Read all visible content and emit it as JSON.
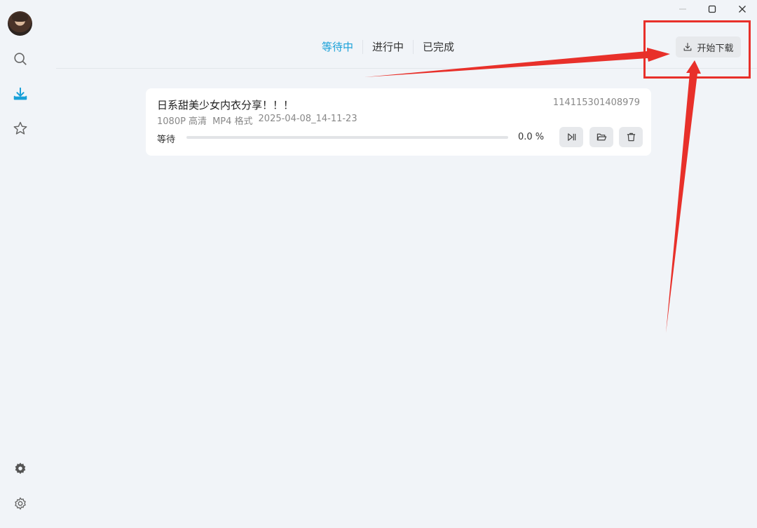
{
  "window": {
    "controls": [
      "minimize",
      "maximize",
      "close"
    ]
  },
  "sidebar": {
    "items": [
      {
        "name": "search",
        "icon": "search-icon"
      },
      {
        "name": "download",
        "icon": "download-icon",
        "active": true
      },
      {
        "name": "favorites",
        "icon": "star-icon"
      },
      {
        "name": "plugin",
        "icon": "gear-badge-icon"
      },
      {
        "name": "settings",
        "icon": "gear-icon"
      }
    ]
  },
  "tabs": [
    {
      "label": "等待中",
      "active": true
    },
    {
      "label": "进行中",
      "active": false
    },
    {
      "label": "已完成",
      "active": false
    }
  ],
  "toolbar": {
    "start_label": "开始下载"
  },
  "task": {
    "title": "日系甜美少女内衣分享！！！",
    "id": "114115301408979",
    "quality": "1080P 高清",
    "format": "MP4 格式",
    "timestamp": "2025-04-08_14-11-23",
    "status": "等待",
    "progress": 0.0,
    "percent_text": "0.0 %"
  },
  "colors": {
    "accent": "#18a0d8",
    "annotation": "#e8302a",
    "background": "#f1f4f8"
  }
}
